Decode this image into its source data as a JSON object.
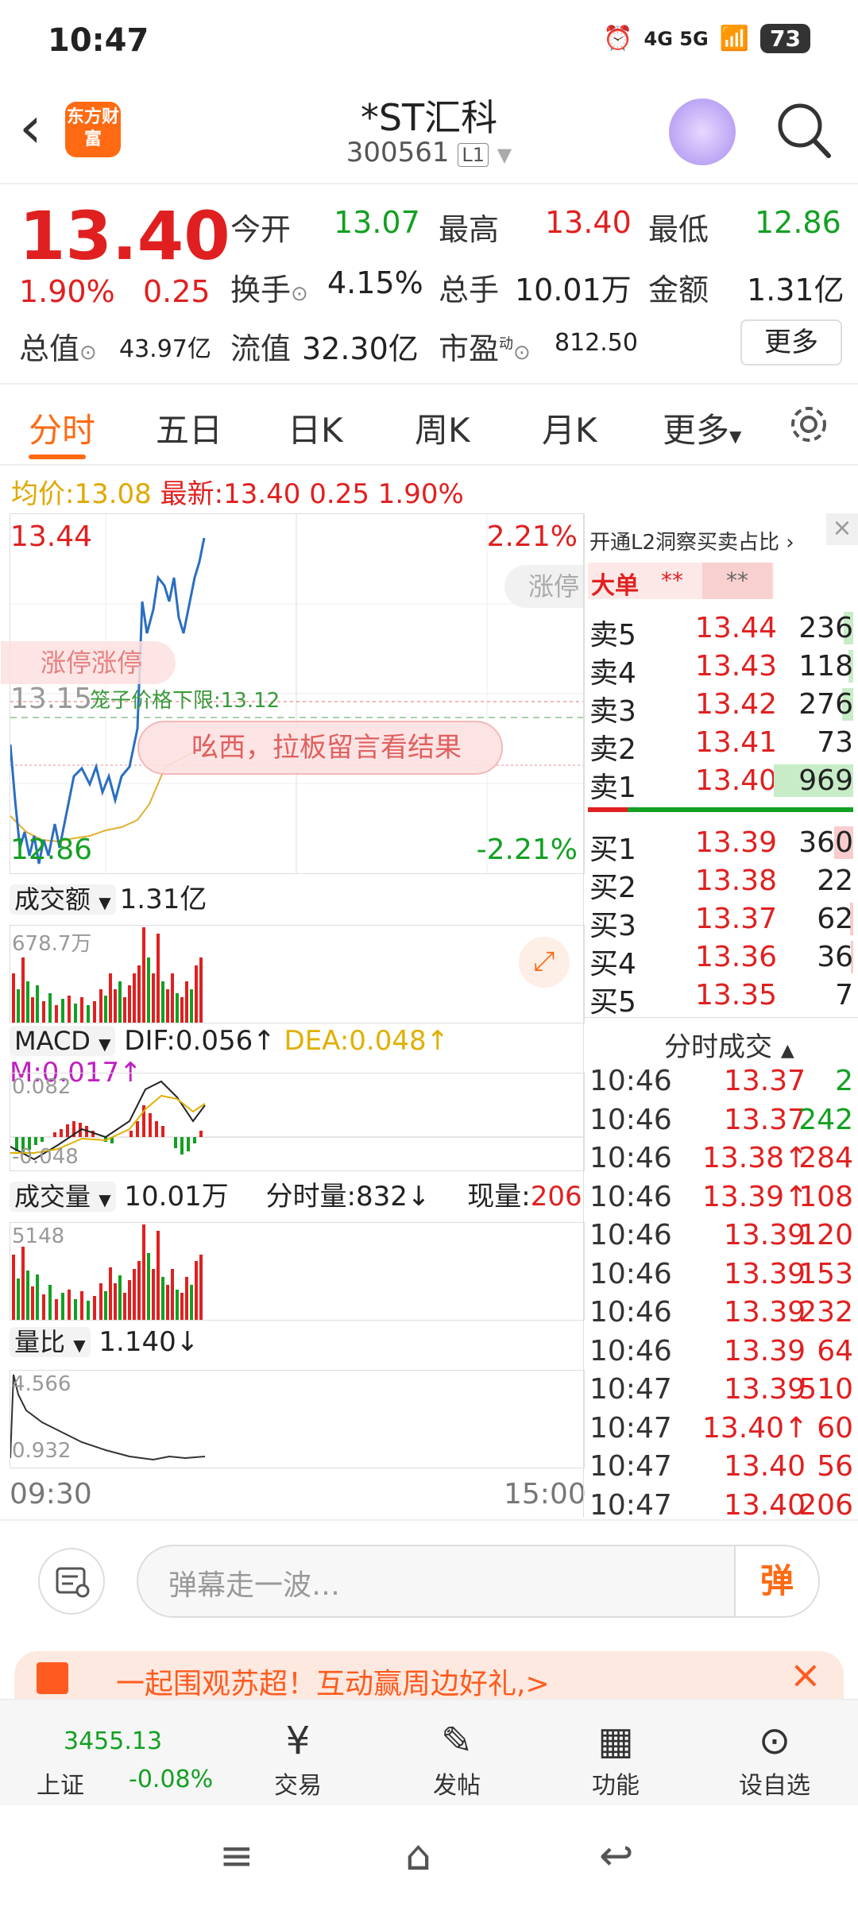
{
  "status_bar": {
    "time": "10:47",
    "network": "4G 5G",
    "battery": "73"
  },
  "header": {
    "app_logo_text": "东方财富",
    "stock_name": "*ST汇科",
    "stock_code": "300561",
    "level_badge": "L1"
  },
  "quote": {
    "price": "13.40",
    "change_pct": "1.90%",
    "change": "0.25",
    "metrics": [
      {
        "label": "今开",
        "value": "13.07"
      },
      {
        "label": "最高",
        "value": "13.40"
      },
      {
        "label": "最低",
        "value": "12.86"
      },
      {
        "label": "换手",
        "value": "4.15%"
      },
      {
        "label": "总手",
        "value": "10.01万"
      },
      {
        "label": "金额",
        "value": "1.31亿"
      },
      {
        "label": "总值",
        "value": "43.97亿"
      },
      {
        "label": "流值",
        "value": "32.30亿"
      },
      {
        "label": "市盈",
        "value": "812.50"
      }
    ],
    "pe_sup": "动",
    "more_button": "更多"
  },
  "tabs": [
    "分时",
    "五日",
    "日K",
    "周K",
    "月K",
    "更多"
  ],
  "chart": {
    "avg_label": "均价:",
    "avg_value": "13.08",
    "latest_label": "最新:",
    "latest_value": "13.40",
    "latest_change": "0.25",
    "latest_pct": "1.90%",
    "y_high": "13.44",
    "y_mid": "13.15",
    "y_low": "12.86",
    "pct_high": "2.21%",
    "pct_low": "-2.21%",
    "limit_up_tag": "涨停",
    "limit_badge": "涨停涨停",
    "cage_label": "笼子价格下限:",
    "cage_value": "13.12",
    "promo_bubble": "吆西，拉板留言看结果",
    "turnover_label": "成交额",
    "turnover_value": "1.31亿",
    "turnover_max": "678.7万",
    "macd_label": "MACD",
    "dif": "DIF:0.056↑",
    "dea": "DEA:0.048↑",
    "m": "M:0.017↑",
    "macd_top": "0.082",
    "macd_bottom": "-0.048",
    "volume_label": "成交量",
    "volume_value": "10.01万",
    "fenshi_label": "分时量:",
    "fenshi_value": "832↓",
    "xianliang_label": "现量:",
    "xianliang_value": "206",
    "volume_max": "5148",
    "ratio_label": "量比",
    "ratio_value": "1.140↓",
    "ratio_top": "4.566",
    "ratio_bottom": "0.932",
    "x_start": "09:30",
    "x_end": "15:00"
  },
  "orderbook": {
    "l2_promo": "开通L2洞察买卖占比",
    "big_order_label": "大单",
    "big_order_a": "**",
    "big_order_b": "**",
    "sells": [
      {
        "label": "卖5",
        "price": "13.44",
        "vol": "236"
      },
      {
        "label": "卖4",
        "price": "13.43",
        "vol": "118"
      },
      {
        "label": "卖3",
        "price": "13.42",
        "vol": "276"
      },
      {
        "label": "卖2",
        "price": "13.41",
        "vol": "73"
      },
      {
        "label": "卖1",
        "price": "13.40",
        "vol": "969"
      }
    ],
    "buys": [
      {
        "label": "买1",
        "price": "13.39",
        "vol": "360"
      },
      {
        "label": "买2",
        "price": "13.38",
        "vol": "22"
      },
      {
        "label": "买3",
        "price": "13.37",
        "vol": "62"
      },
      {
        "label": "买4",
        "price": "13.36",
        "vol": "36"
      },
      {
        "label": "买5",
        "price": "13.35",
        "vol": "7"
      }
    ],
    "ticks_title": "分时成交",
    "ticks": [
      {
        "t": "10:46",
        "p": "13.37",
        "v": "2",
        "c": "green"
      },
      {
        "t": "10:46",
        "p": "13.37",
        "v": "242",
        "c": "green"
      },
      {
        "t": "10:46",
        "p": "13.38↑",
        "v": "284",
        "c": "red"
      },
      {
        "t": "10:46",
        "p": "13.39↑",
        "v": "108",
        "c": "red"
      },
      {
        "t": "10:46",
        "p": "13.39",
        "v": "120",
        "c": "red"
      },
      {
        "t": "10:46",
        "p": "13.39",
        "v": "153",
        "c": "red"
      },
      {
        "t": "10:46",
        "p": "13.39",
        "v": "232",
        "c": "red"
      },
      {
        "t": "10:46",
        "p": "13.39",
        "v": "64",
        "c": "red"
      },
      {
        "t": "10:47",
        "p": "13.39",
        "v": "510",
        "c": "red"
      },
      {
        "t": "10:47",
        "p": "13.40↑",
        "v": "60",
        "c": "red"
      },
      {
        "t": "10:47",
        "p": "13.40",
        "v": "56",
        "c": "red"
      },
      {
        "t": "10:47",
        "p": "13.40",
        "v": "206",
        "c": "red"
      }
    ]
  },
  "danmu": {
    "placeholder": "弹幕走一波…",
    "send": "弹"
  },
  "banner": {
    "text": "一起围观苏超！互动赢周边好礼,>"
  },
  "bottom_nav": {
    "index_value": "3455.13",
    "index_name": "上证",
    "index_change": "-0.08%",
    "items": [
      "交易",
      "发帖",
      "功能",
      "设自选"
    ]
  },
  "colors": {
    "up": "#e02020",
    "down": "#13a022",
    "accent": "#ff6a13"
  }
}
